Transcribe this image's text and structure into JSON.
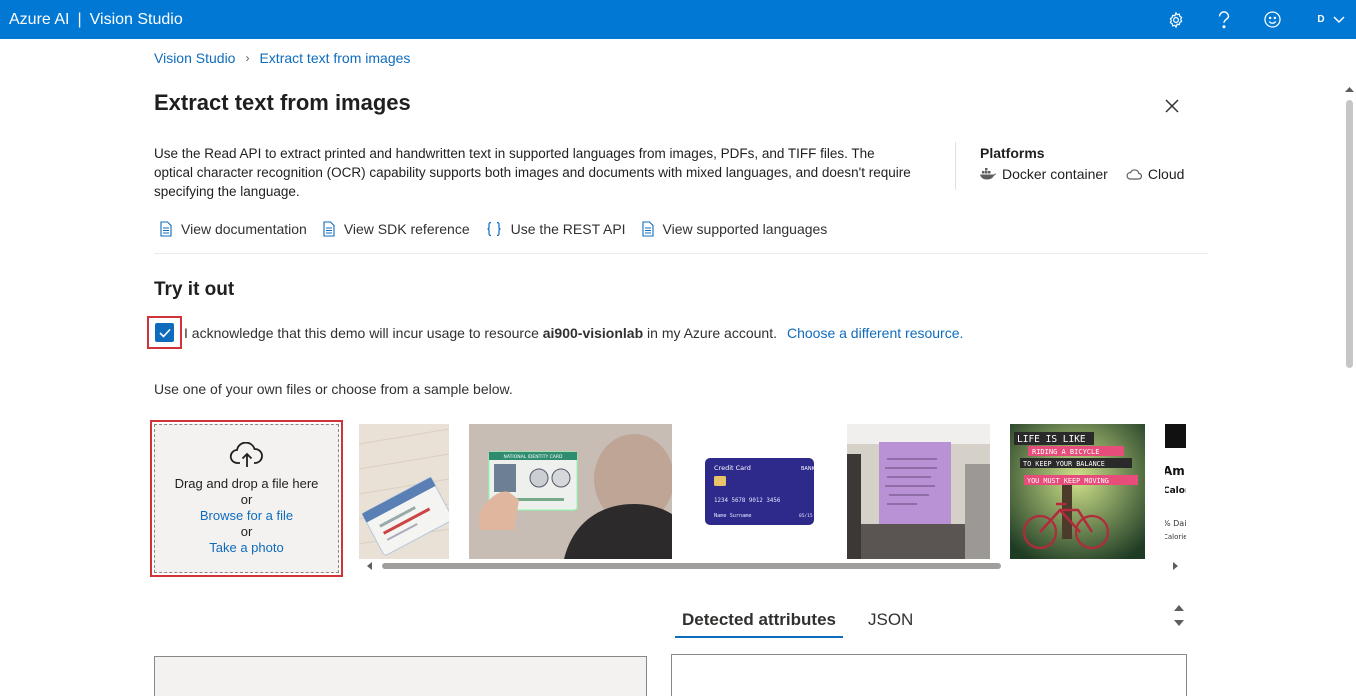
{
  "topbar": {
    "brand_azure": "Azure AI",
    "brand_sep": "|",
    "brand_product": "Vision Studio",
    "avatar_initial": "D"
  },
  "breadcrumb": {
    "items": [
      "Vision Studio",
      "Extract text from images"
    ]
  },
  "page": {
    "title": "Extract text from images",
    "description": "Use the Read API to extract printed and handwritten text in supported languages from images, PDFs, and TIFF files. The optical character recognition (OCR) capability supports both images and documents with mixed languages, and doesn't require specifying the language."
  },
  "platforms": {
    "heading": "Platforms",
    "items": [
      "Docker container",
      "Cloud"
    ]
  },
  "links": [
    "View documentation",
    "View SDK reference",
    "Use the REST API",
    "View supported languages"
  ],
  "try": {
    "title": "Try it out",
    "ack_prefix": "I acknowledge that this demo will incur usage to resource ",
    "ack_resource": "ai900-visionlab",
    "ack_suffix": " in my Azure account.",
    "ack_link": "Choose a different resource.",
    "ack_checked": true,
    "instructions": "Use one of your own files or choose from a sample below."
  },
  "upload": {
    "drag_text": "Drag and drop a file here",
    "or1": "or",
    "browse_link": "Browse for a file",
    "or2": "or",
    "photo_link": "Take a photo"
  },
  "samples": {
    "card_text": "Credit Card",
    "bank_text": "BANK",
    "card_number": "1234 5678 9012 3456",
    "card_name": "Name Surname",
    "card_exp": "05/15",
    "id_card_title": "NATIONAL IDENTITY CARD",
    "poster_lines": [
      "LIFE IS LIKE",
      "RIDING A BICYCLE",
      "TO KEEP YOUR BALANCE",
      "YOU MUST KEEP MOVING"
    ],
    "label_lines": [
      "Am",
      "Calori",
      "% Dail",
      "Calorie"
    ]
  },
  "results": {
    "tabs": [
      "Detected attributes",
      "JSON"
    ],
    "active_tab": "Detected attributes"
  },
  "colors": {
    "brand_blue": "#0078d4",
    "link_blue": "#0f6cbd",
    "highlight_red": "#d13438"
  }
}
